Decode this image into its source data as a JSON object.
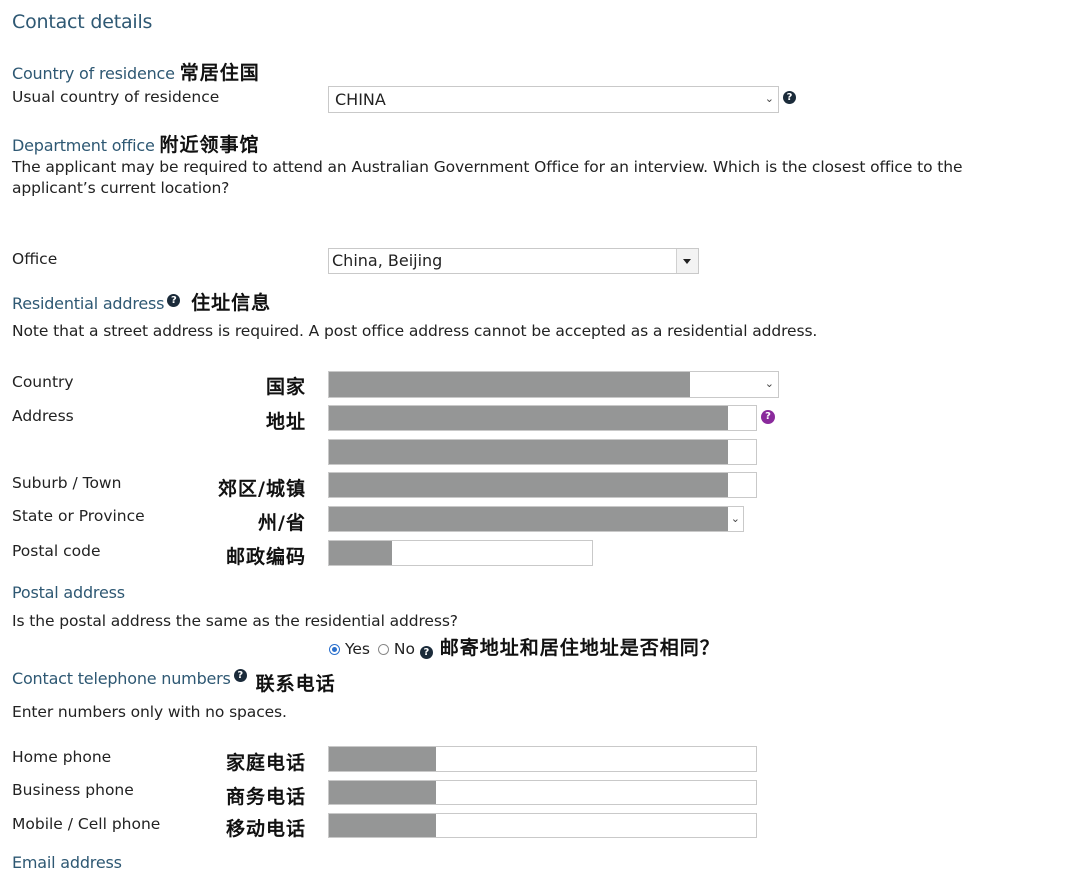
{
  "page": {
    "title": "Contact details"
  },
  "country_of_residence": {
    "heading": "Country of residence",
    "heading_cn": "常居住国",
    "label": "Usual country of residence",
    "value": "CHINA",
    "help_icon": "question-circle-icon"
  },
  "department_office": {
    "heading": "Department office",
    "heading_cn": "附近领事馆",
    "description_line1": "The applicant may be required to attend an Australian Government Office for an interview. Which is the closest office to the",
    "description_line2": "applicant’s current location?",
    "office_label": "Office",
    "office_value": "China, Beijing"
  },
  "residential_address": {
    "heading": "Residential address",
    "heading_cn": "住址信息",
    "note": "Note that a street address is required. A post office address cannot be accepted as a residential address.",
    "fields": [
      {
        "label": "Country",
        "label_cn": "国家",
        "value": "[redacted]"
      },
      {
        "label": "Address",
        "label_cn": "地址",
        "value": "[redacted]"
      },
      {
        "label": "",
        "label_cn": "",
        "value": "[redacted]"
      },
      {
        "label": "Suburb / Town",
        "label_cn": "郊区/城镇",
        "value": "[redacted]"
      },
      {
        "label": "State or Province",
        "label_cn": "州/省",
        "value": "[redacted]"
      },
      {
        "label": "Postal code",
        "label_cn": "邮政编码",
        "value": "[redacted]"
      }
    ]
  },
  "postal_address": {
    "heading": "Postal address",
    "question": "Is the postal address the same as the residential address?",
    "options": [
      {
        "label": "Yes",
        "selected": true
      },
      {
        "label": "No",
        "selected": false
      }
    ],
    "question_cn": "邮寄地址和居住地址是否相同？"
  },
  "contact_phone": {
    "heading": "Contact telephone numbers",
    "heading_cn": "联系电话",
    "note": "Enter numbers only with no spaces.",
    "fields": [
      {
        "label": "Home phone",
        "label_cn": "家庭电话",
        "value": "[redacted]"
      },
      {
        "label": "Business phone",
        "label_cn": "商务电话",
        "value": "[redacted]"
      },
      {
        "label": "Mobile / Cell phone",
        "label_cn": "移动电话",
        "value": "[redacted]"
      }
    ]
  },
  "email": {
    "heading": "Email address"
  },
  "colors": {
    "heading": "#2e5873",
    "help_icon_dark": "#1b2b3a",
    "help_icon_purple": "#8a2a9c",
    "redaction": "#959696",
    "radio_selected": "#2a6fcc"
  }
}
